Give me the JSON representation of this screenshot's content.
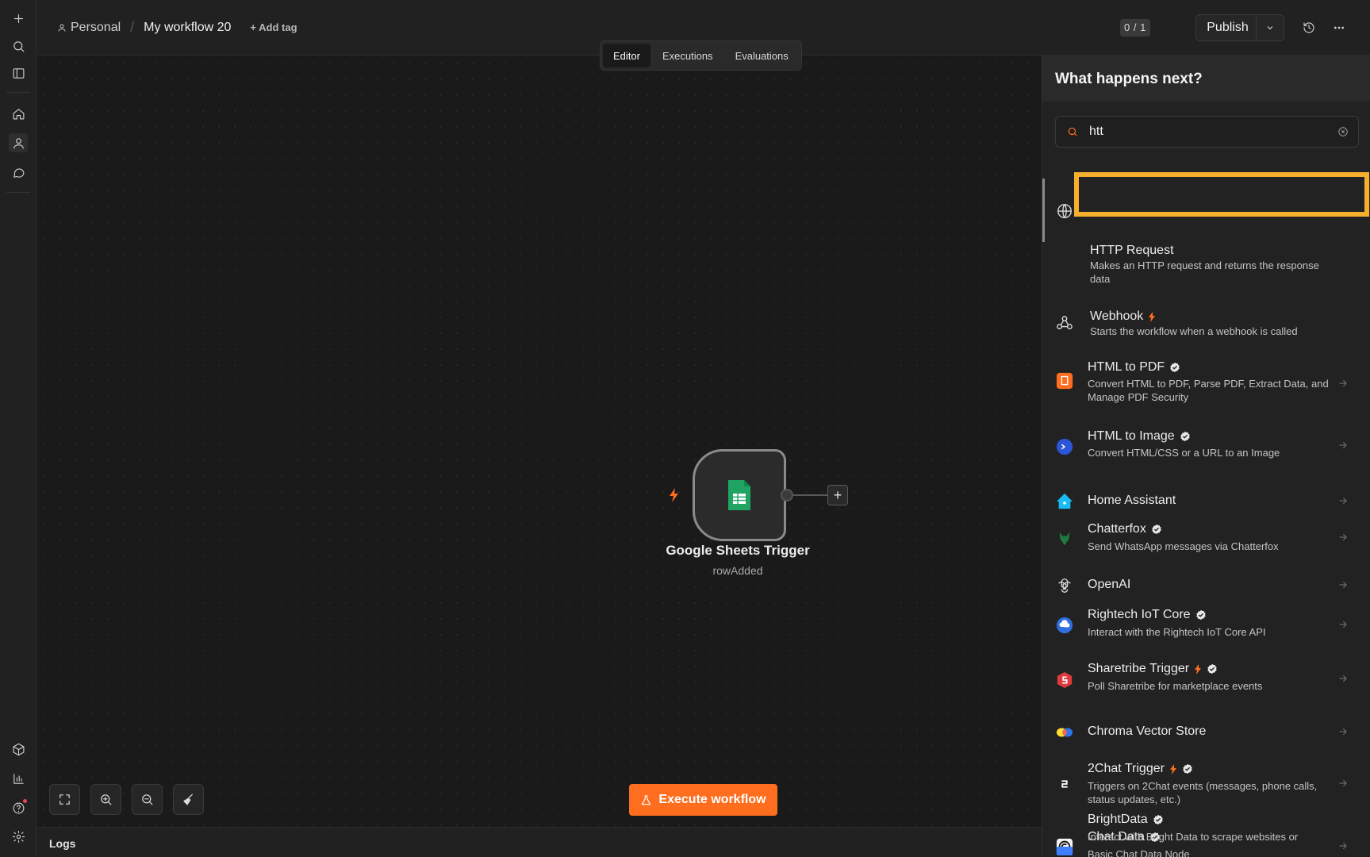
{
  "breadcrumb": {
    "personal": "Personal",
    "workflow": "My workflow 20",
    "add_tag": "+ Add tag"
  },
  "header": {
    "counter": "0 / 1",
    "publish": "Publish"
  },
  "tabs": [
    "Editor",
    "Executions",
    "Evaluations"
  ],
  "node": {
    "title": "Google Sheets Trigger",
    "subtitle": "rowAdded"
  },
  "execute": "Execute workflow",
  "logs": "Logs",
  "panel": {
    "title": "What happens next?",
    "search_value": "htt",
    "items": [
      {
        "title": "HTTP Request",
        "desc": "Makes an HTTP request and returns the response data",
        "icon": "globe-icon"
      },
      {
        "title": "Webhook",
        "desc": "Starts the workflow when a webhook is called",
        "icon": "webhook-icon"
      },
      {
        "title": "HTML to PDF",
        "desc": "Convert HTML to PDF, Parse PDF, Extract Data, and Manage PDF Security",
        "icon": "html-to-pdf-icon"
      },
      {
        "title": "HTML to Image",
        "desc": "Convert HTML/CSS or a URL to an Image",
        "icon": "html-to-image-icon"
      },
      {
        "title": "Home Assistant",
        "desc": "",
        "icon": "home-assistant-icon"
      },
      {
        "title": "Chatterfox",
        "desc": "Send WhatsApp messages via Chatterfox",
        "icon": "chatterfox-icon"
      },
      {
        "title": "OpenAI",
        "desc": "",
        "icon": "openai-icon"
      },
      {
        "title": "Rightech IoT Core",
        "desc": "Interact with the Rightech IoT Core API",
        "icon": "rightech-icon"
      },
      {
        "title": "Sharetribe Trigger",
        "desc": "Poll Sharetribe for marketplace events",
        "icon": "sharetribe-icon"
      },
      {
        "title": "Chroma Vector Store",
        "desc": "",
        "icon": "chroma-icon"
      },
      {
        "title": "2Chat Trigger",
        "desc": "Triggers on 2Chat events (messages, phone calls, status updates, etc.)",
        "icon": "2chat-icon"
      },
      {
        "title": "Chat Data",
        "desc": "Basic Chat Data Node",
        "icon": "chat-data-icon"
      },
      {
        "title": "BrightData",
        "desc": "Interact with Bright Data to scrape websites or",
        "icon": "brightdata-icon"
      }
    ]
  },
  "colors": {
    "accent": "#ff6d1f",
    "highlight": "#f6ae2d",
    "sheets_green": "#1fa463"
  }
}
